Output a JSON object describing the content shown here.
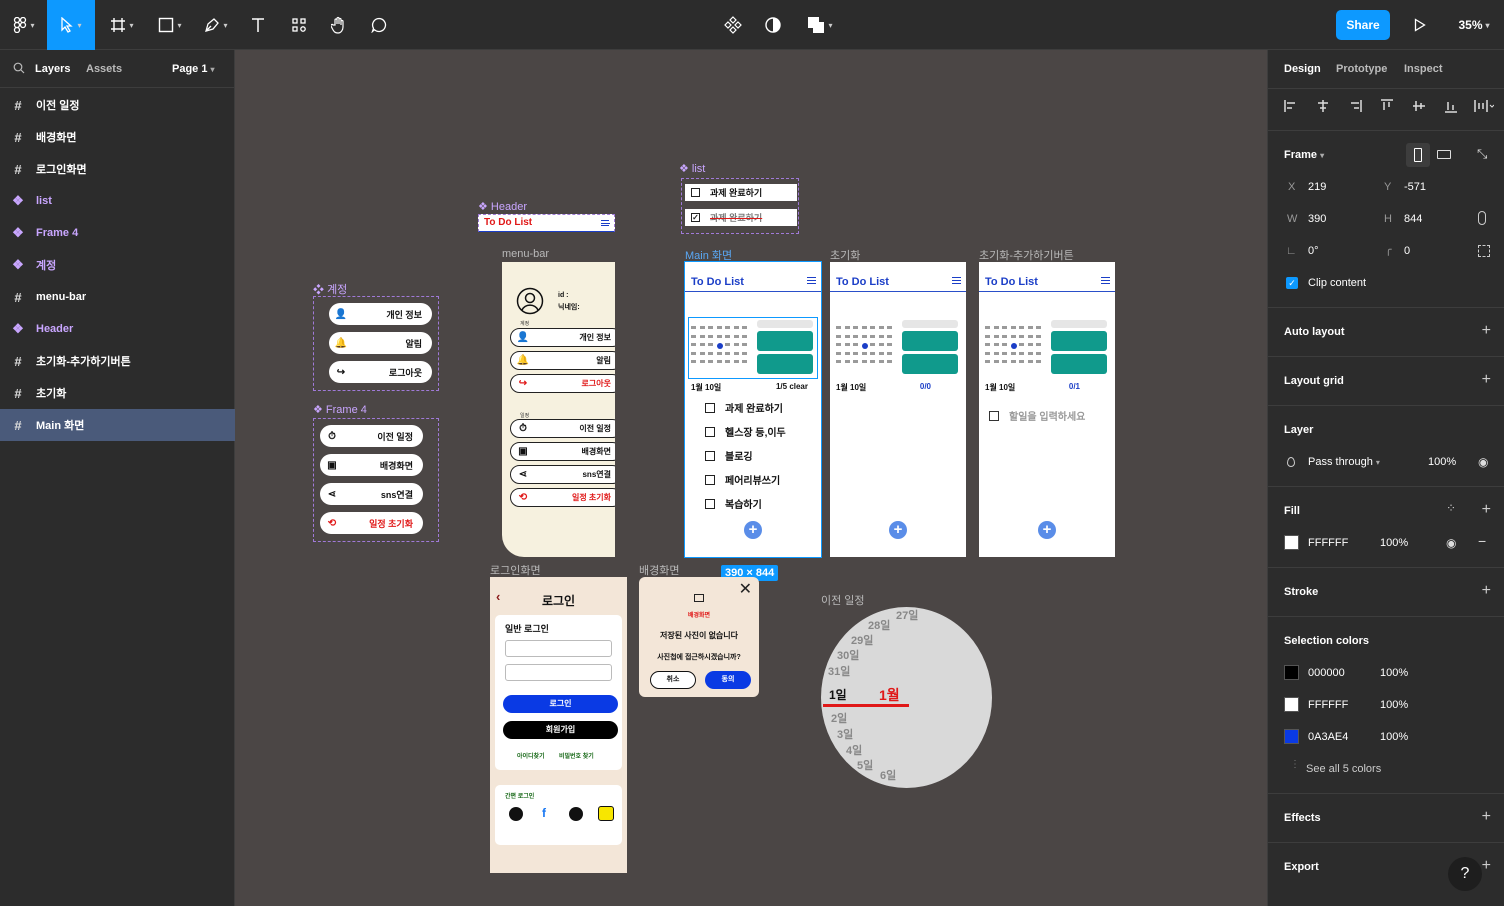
{
  "toolbar": {
    "share_label": "Share",
    "zoom": "35%"
  },
  "left_panel": {
    "tabs": {
      "layers": "Layers",
      "assets": "Assets",
      "page": "Page 1"
    },
    "layers": [
      {
        "label": "이전 일정",
        "kind": "frame"
      },
      {
        "label": "배경화면",
        "kind": "frame"
      },
      {
        "label": "로그인화면",
        "kind": "frame"
      },
      {
        "label": "list",
        "kind": "component"
      },
      {
        "label": "Frame 4",
        "kind": "component"
      },
      {
        "label": "계정",
        "kind": "component"
      },
      {
        "label": "menu-bar",
        "kind": "frame"
      },
      {
        "label": "Header",
        "kind": "component"
      },
      {
        "label": "초기화-추가하기버튼",
        "kind": "frame"
      },
      {
        "label": "초기화",
        "kind": "frame"
      },
      {
        "label": "Main 화면",
        "kind": "frame",
        "selected": true
      }
    ]
  },
  "canvas": {
    "labels": {
      "list": "list",
      "header": "Header",
      "menu_bar": "menu-bar",
      "main": "Main 화면",
      "init": "초기화",
      "init_add": "초기화-추가하기버튼",
      "account": "계정",
      "frame4": "Frame 4",
      "login": "로그인화면",
      "background": "배경화면",
      "previous": "이전 일정",
      "size_badge": "390 × 844"
    },
    "app_title": "To Do List",
    "list_items": [
      "과제 완료하기",
      "과제 완료하기"
    ],
    "account_items": [
      "개인 정보",
      "알림",
      "로그아웃"
    ],
    "frame4_items": [
      "이전 일정",
      "배경화면",
      "sns연결",
      "일정 초기화"
    ],
    "menu": {
      "user_label": "id :",
      "user_sub": "닉네임:",
      "section1": "계정",
      "section2": "일정",
      "items1": [
        "개인 정보",
        "알림",
        "로그아웃"
      ],
      "items2": [
        "이전 일정",
        "배경화면",
        "sns연결",
        "일정 초기화"
      ]
    },
    "main": {
      "date": "1월 10일",
      "count": "1/5 clear",
      "todos": [
        "과제 완료하기",
        "헬스장 등,이두",
        "블로깅",
        "페어리뷰쓰기",
        "복습하기"
      ]
    },
    "init": {
      "date": "1월 10일",
      "count": "0/0"
    },
    "init_add": {
      "date": "1월 10일",
      "count": "0/1",
      "placeholder": "할일을 입력하세요"
    },
    "login": {
      "title": "로그인",
      "section": "일반 로그인",
      "login_btn": "로그인",
      "signup_btn": "회원가입",
      "find_id": "아이디찾기",
      "find_pw": "비밀번호 찾기",
      "easy": "간편 로그인"
    },
    "bg": {
      "title": "배경화면",
      "msg1": "저장된 사진이 없습니다",
      "msg2": "사진첩에 접근하시겠습니까?",
      "cancel": "취소",
      "ok": "동의"
    },
    "wheel": {
      "days_before": [
        "27일",
        "28일",
        "29일",
        "30일",
        "31일"
      ],
      "selected_day": "1일",
      "selected_month": "1월",
      "days_after": [
        "2일",
        "3일",
        "4일",
        "5일",
        "6일"
      ]
    }
  },
  "right_panel": {
    "tabs": {
      "design": "Design",
      "prototype": "Prototype",
      "inspect": "Inspect"
    },
    "frame": {
      "title": "Frame",
      "x": "219",
      "y": "-571",
      "w": "390",
      "h": "844",
      "rotation": "0°",
      "radius": "0",
      "clip": "Clip content"
    },
    "sections": {
      "auto_layout": "Auto layout",
      "layout_grid": "Layout grid",
      "layer": "Layer",
      "fill": "Fill",
      "stroke": "Stroke",
      "selection_colors": "Selection colors",
      "effects": "Effects",
      "export": "Export"
    },
    "layer": {
      "blend": "Pass through",
      "opacity": "100%"
    },
    "fill": {
      "hex": "FFFFFF",
      "opacity": "100%"
    },
    "selection_colors": [
      {
        "hex": "000000",
        "opacity": "100%",
        "color": "#000000"
      },
      {
        "hex": "FFFFFF",
        "opacity": "100%",
        "color": "#FFFFFF"
      },
      {
        "hex": "0A3AE4",
        "opacity": "100%",
        "color": "#0A3AE4"
      }
    ],
    "see_all": "See all 5 colors"
  }
}
